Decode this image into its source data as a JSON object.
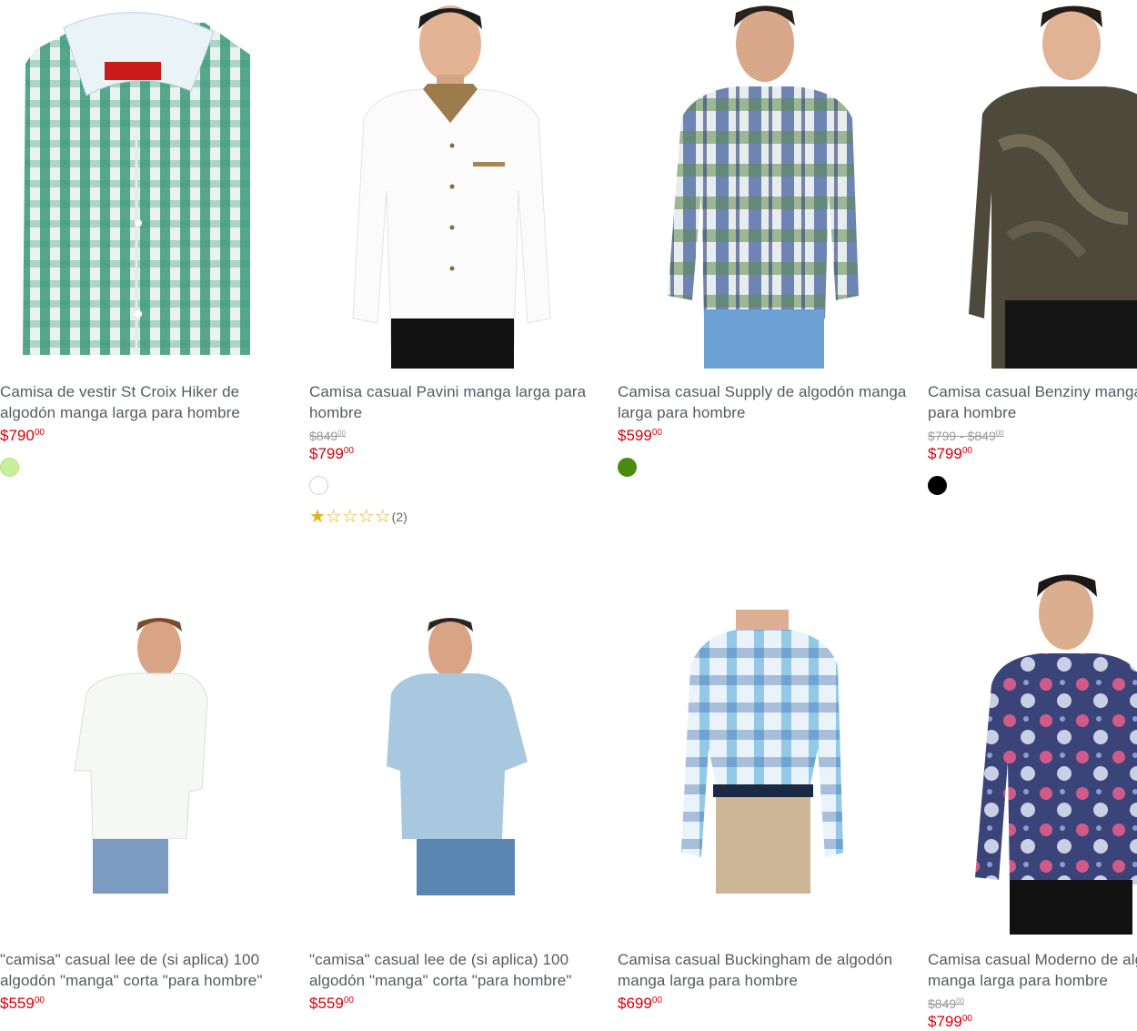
{
  "products": [
    {
      "title_lines": [
        "Camisa de vestir St Croix Hiker de",
        "algodón manga larga para hombre"
      ],
      "old_price": "",
      "price": "$790",
      "price_cents": "00",
      "swatch": "#c8f09a",
      "image": "green-gingham-shirt-folded"
    },
    {
      "title_lines": [
        "Camisa casual Pavini manga larga para",
        "hombre"
      ],
      "old_price": "$849",
      "old_cents": "00",
      "price": "$799",
      "price_cents": "00",
      "swatch": "#ffffff",
      "rating_stars": "★☆☆☆☆",
      "rating_count": "(2)",
      "image": "white-shirt-model"
    },
    {
      "title_lines": [
        "Camisa casual Supply de algodón manga",
        "larga para hombre"
      ],
      "old_price": "",
      "price": "$599",
      "price_cents": "00",
      "swatch": "#4a8a10",
      "image": "plaid-blue-green-shirt-model"
    },
    {
      "title_lines": [
        "Camisa casual Benziny manga larga",
        "para hombre"
      ],
      "old_price": "$799 - $849",
      "old_cents": "00",
      "price": "$799",
      "price_cents": "00",
      "swatch": "#000000",
      "image": "dark-floral-shirt-model"
    },
    {
      "title_lines": [
        "\"camisa\" casual lee de (si aplica) 100",
        "algodón \"manga\" corta \"para hombre\""
      ],
      "old_price": "",
      "price": "$559",
      "price_cents": "00",
      "image": "white-short-sleeve-model"
    },
    {
      "title_lines": [
        "\"camisa\" casual lee de (si aplica) 100",
        "algodón \"manga\" corta \"para hombre\""
      ],
      "old_price": "",
      "price": "$559",
      "price_cents": "00",
      "image": "light-blue-short-sleeve-model"
    },
    {
      "title_lines": [
        "Camisa casual Buckingham de algodón",
        "manga larga para hombre"
      ],
      "old_price": "",
      "price": "$699",
      "price_cents": "00",
      "image": "blue-plaid-shirt-khakis-model"
    },
    {
      "title_lines": [
        "Camisa casual Moderno de algodón",
        "manga larga para hombre"
      ],
      "old_price": "$849",
      "old_cents": "00",
      "price": "$799",
      "price_cents": "00",
      "image": "navy-print-shirt-model"
    }
  ],
  "colors": {
    "price": "#d6000a",
    "old_price": "#9a9a9a",
    "title": "#555a60",
    "star": "#e5b21c"
  }
}
